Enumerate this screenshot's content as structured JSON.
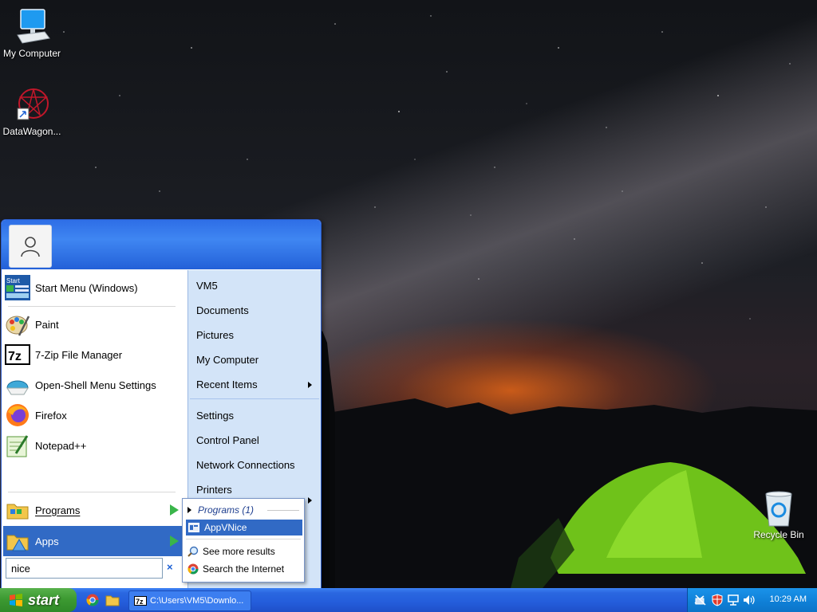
{
  "desktop": {
    "icons": [
      {
        "label": "My Computer",
        "icon": "my-computer-icon"
      },
      {
        "label": "DataWagon...",
        "icon": "datawagon-shortcut-icon"
      },
      {
        "label": "Recycle Bin",
        "icon": "recycle-bin-icon"
      }
    ]
  },
  "start_menu": {
    "user_icon": "user-avatar-icon",
    "pinned": [
      {
        "label": "Start Menu (Windows)",
        "icon": "start-menu-windows-icon"
      },
      {
        "label": "Paint",
        "icon": "paint-icon"
      },
      {
        "label": "7-Zip File Manager",
        "icon": "7zip-icon"
      },
      {
        "label": "Open-Shell Menu Settings",
        "icon": "open-shell-icon"
      },
      {
        "label": "Firefox",
        "icon": "firefox-icon"
      },
      {
        "label": "Notepad++",
        "icon": "notepadpp-icon"
      }
    ],
    "programs_label": "Programs",
    "apps_label": "Apps",
    "search_value": "nice",
    "clear_glyph": "×",
    "right_items": [
      {
        "label": "VM5"
      },
      {
        "label": "Documents"
      },
      {
        "label": "Pictures"
      },
      {
        "label": "My Computer"
      },
      {
        "label": "Recent Items"
      },
      {
        "label": "Settings"
      },
      {
        "label": "Control Panel"
      },
      {
        "label": "Network Connections"
      },
      {
        "label": "Printers"
      }
    ]
  },
  "search_results": {
    "header": "Programs (1)",
    "app": "AppVNice",
    "see_more": "See more results",
    "search_internet": "Search the Internet"
  },
  "taskbar": {
    "start_label": "start",
    "task_label": "C:\\Users\\VM5\\Downlo...",
    "clock": "10:29 AM"
  },
  "colors": {
    "taskbar_blue": "#245ddb",
    "start_green": "#3d9a32",
    "selection_blue": "#316ac5",
    "right_pane": "#d3e4f8"
  }
}
